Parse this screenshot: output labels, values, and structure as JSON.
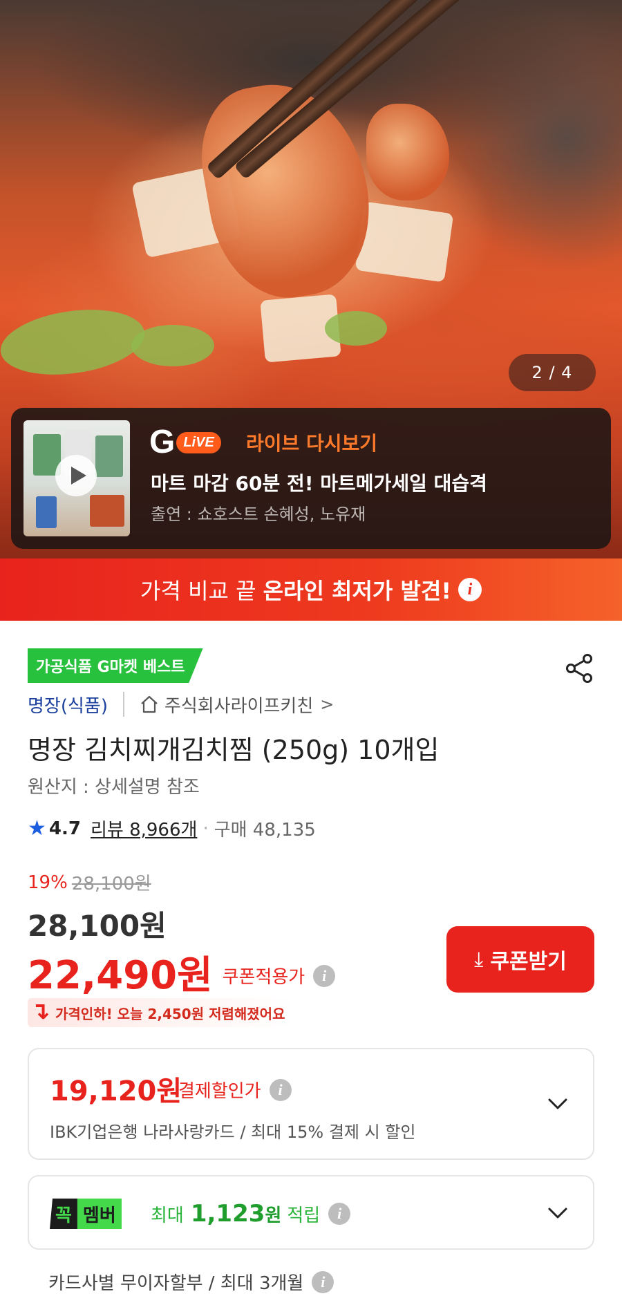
{
  "hero": {
    "page_counter": "2 / 4",
    "live": {
      "brand_g": "G",
      "brand_live": "LiVE",
      "replay_label": "라이브 다시보기",
      "title": "마트 마감 60분 전! 마트메가세일 대습격",
      "cast": "출연 : 쇼호스트 손혜성, 노유재"
    }
  },
  "banner": {
    "text": "가격 비교 끝",
    "strong": "온라인 최저가 발견!"
  },
  "product": {
    "best_badge": "가공식품 G마켓 베스트",
    "brand": "명장(식품)",
    "store": "주식회사라이프키친",
    "store_chevron": ">",
    "title": "명장 김치찌개김치찜 (250g) 10개입",
    "origin": "원산지 : 상세설명 참조",
    "rating": {
      "star": "★",
      "score": "4.7",
      "review": "리뷰 8,966개",
      "separator": "·",
      "purchase": "구매 48,135"
    }
  },
  "price": {
    "discount_rate": "19%",
    "original_price": "28,100원",
    "price": "28,100원",
    "coupon_price": "22,490원",
    "coupon_label": "쿠폰적용가",
    "coupon_button": "쿠폰받기",
    "coupon_button_icon": "⤓",
    "price_drop": "가격인하! 오늘 2,450원 저렴해졌어요"
  },
  "payment": {
    "amount": "19,120원",
    "label": "결제할인가",
    "desc": "IBK기업은행 나라사랑카드 / 최대 15% 결제 시 할인"
  },
  "member": {
    "logo_a": "꼭",
    "logo_b": "멤버",
    "prefix": "최대",
    "amount": "1,123",
    "won": "원",
    "suffix": "적립"
  },
  "installment": {
    "text": "카드사별 무이자할부 / 최대 3개월"
  },
  "icons": {
    "info": "i"
  },
  "colors": {
    "accent_red": "#e8231d",
    "best_green": "#28c13e",
    "member_green": "#43d94b",
    "brand_blue": "#1a3f9c",
    "live_orange": "#ff5b1a"
  }
}
